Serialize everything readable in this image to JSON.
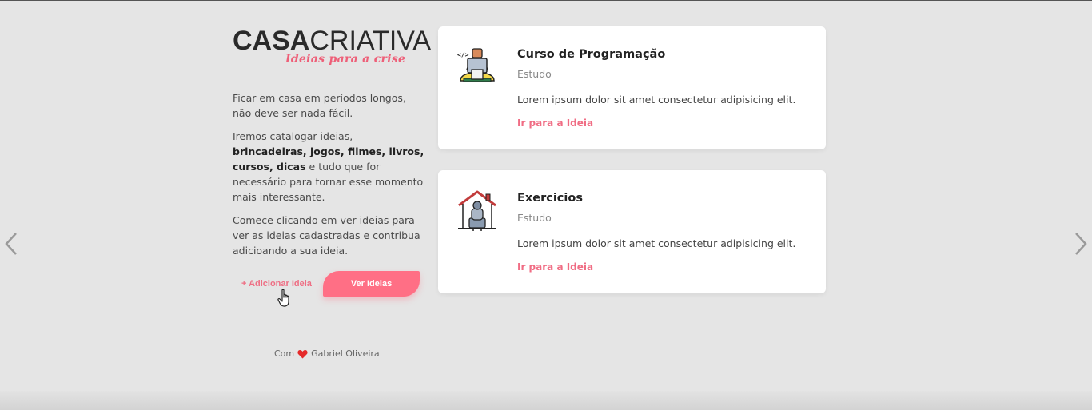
{
  "logo": {
    "brand_bold": "CASA",
    "brand_light": "CRIATIVA",
    "tagline": "Ideias para a crise"
  },
  "sidebar": {
    "paragraph1": "Ficar em casa em períodos longos, não deve ser nada fácil.",
    "paragraph2_prefix": "Iremos catalogar ideias, ",
    "paragraph2_bold": "brincadeiras, jogos, filmes, livros, cursos, dicas",
    "paragraph2_suffix": " e tudo que for necessário para tornar esse momento mais interessante.",
    "paragraph3": "Comece clicando em ver ideias para ver as ideias cadastradas e contribua adicioando a sua ideia.",
    "add_label": "+ Adicionar Ideia",
    "view_label": "Ver Ideias"
  },
  "footer": {
    "prefix": "Com",
    "author": "Gabriel Oliveira"
  },
  "ideas": [
    {
      "title": "Curso de Programação",
      "category": "Estudo",
      "description": "Lorem ipsum dolor sit amet consectetur adipisicing elit.",
      "link": "Ir para a Ideia",
      "icon": "programmer-icon"
    },
    {
      "title": "Exercicios",
      "category": "Estudo",
      "description": "Lorem ipsum dolor sit amet consectetur adipisicing elit.",
      "link": "Ir para a Ideia",
      "icon": "home-exercise-icon"
    }
  ],
  "colors": {
    "accent": "#ff6f85",
    "link": "#f06d84",
    "background": "#e5e5e5"
  }
}
